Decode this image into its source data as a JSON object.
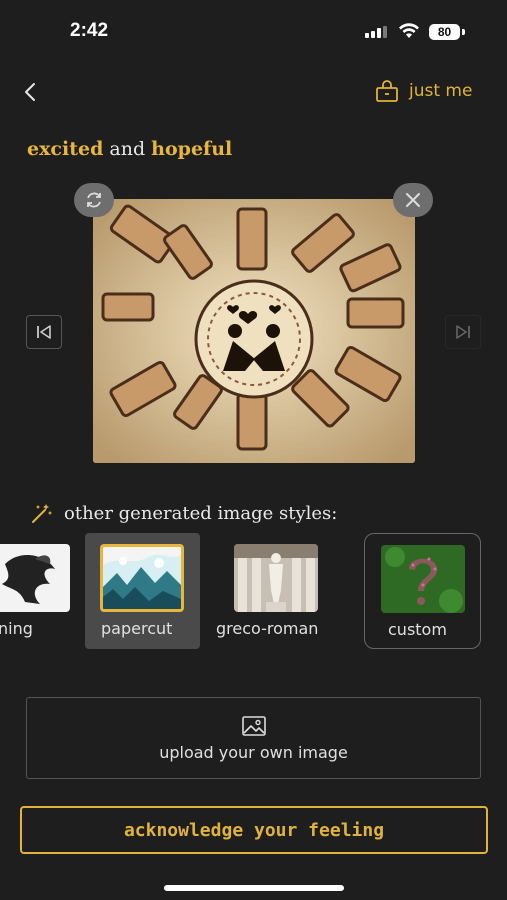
{
  "status": {
    "time": "2:42",
    "battery": "80"
  },
  "header": {
    "back_icon": "chevron-left-icon",
    "privacy_icon": "lock-icon",
    "privacy_label": "just me"
  },
  "feeling": {
    "first": "excited",
    "connector": " and ",
    "second": "hopeful"
  },
  "image": {
    "regenerate_icon": "refresh-icon",
    "close_icon": "close-icon",
    "prev_icon": "skip-previous-icon",
    "next_icon": "skip-next-icon"
  },
  "styles": {
    "heading": "other generated image styles:",
    "heading_icon": "magic-wand-icon",
    "items": [
      {
        "label": "ning"
      },
      {
        "label": "papercut"
      },
      {
        "label": "greco-roman"
      },
      {
        "label": "custom"
      }
    ]
  },
  "upload": {
    "icon": "image-icon",
    "label": "upload your own image"
  },
  "cta": {
    "label": "acknowledge your feeling"
  },
  "colors": {
    "accent": "#e0b43a",
    "background": "#1e1e1e"
  }
}
